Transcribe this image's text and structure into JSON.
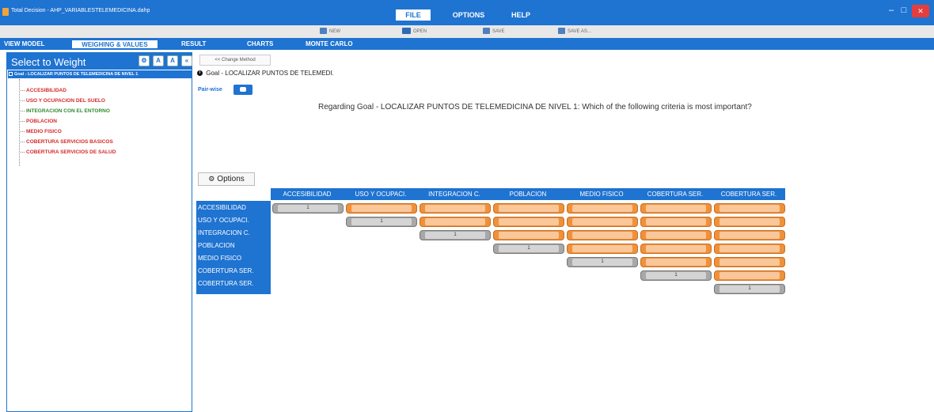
{
  "window": {
    "title": "Total Decision - AHP_VARIABLESTELEMEDICINA.dahp",
    "menu": {
      "file": "FILE",
      "options": "OPTIONS",
      "help": "HELP"
    },
    "controls": {
      "minimize": "–",
      "maximize": "□",
      "close": "✕"
    }
  },
  "toolbar": {
    "new": "NEW",
    "open": "OPEN",
    "save": "SAVE",
    "save_as": "SAVE AS..."
  },
  "nav": {
    "view_model": "VIEW MODEL",
    "weighing": "WEIGHING & VALUES",
    "result": "RESULT",
    "charts": "CHARTS",
    "monte_carlo": "MONTE CARLO"
  },
  "sidebar": {
    "title": "Select to Weight",
    "buttons": [
      "⚙",
      "A",
      "A",
      "«"
    ],
    "goal": "Goal - LOCALIZAR PUNTOS DE TELEMEDICINA DE NIVEL 1",
    "items": [
      {
        "label": "ACCESIBILIDAD",
        "color": "#d42a2a"
      },
      {
        "label": "USO Y OCUPACION DEL SUELO",
        "color": "#d42a2a"
      },
      {
        "label": "INTEGRACION CON EL ENTORNO",
        "color": "#2e8b2e"
      },
      {
        "label": "POBLACION",
        "color": "#d42a2a"
      },
      {
        "label": "MEDIO FISICO",
        "color": "#d42a2a"
      },
      {
        "label": "COBERTURA SERVICIOS BASICOS",
        "color": "#d42a2a"
      },
      {
        "label": "COBERTURA SERVICIOS DE SALUD",
        "color": "#d42a2a"
      }
    ]
  },
  "main": {
    "change_method": "<< Change Method",
    "goal_label": "Goal - LOCALIZAR PUNTOS DE TELEMEDI.",
    "pairwise_label": "Pair-wise",
    "question": "Regarding Goal - LOCALIZAR PUNTOS DE TELEMEDICINA DE NIVEL 1: Which of the following criteria is most important?",
    "options_button": "Options"
  },
  "matrix": {
    "columns": [
      "ACCESIBILIDAD",
      "USO Y OCUPACI.",
      "INTEGRACION C.",
      "POBLACION",
      "MEDIO FISICO",
      "COBERTURA SER.",
      "COBERTURA SER."
    ],
    "rows": [
      "ACCESIBILIDAD",
      "USO Y OCUPACI.",
      "INTEGRACION C.",
      "POBLACION",
      "MEDIO FISICO",
      "COBERTURA SER.",
      "COBERTURA SER."
    ],
    "diagonal_value": "1"
  },
  "colors": {
    "accent": "#1f73d1",
    "pair_cell": "#f0913a",
    "diag_cell": "#a8a8a8"
  }
}
